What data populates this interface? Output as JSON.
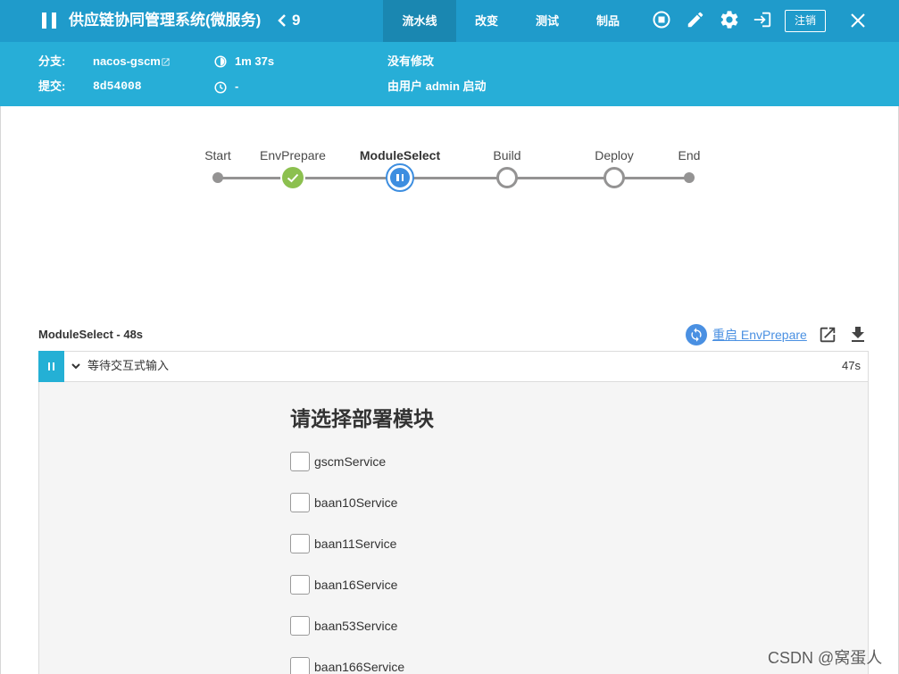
{
  "colors": {
    "header_bar": "#1f9bcb",
    "header_band": "#27aed7",
    "active_tab": "#1a87b1",
    "success": "#8cc04f",
    "paused": "#3d8ee0",
    "step_paused": "#24b0d5",
    "not_built": "#949393",
    "link": "#4a90e2"
  },
  "header": {
    "pause_icon": "pause-icon",
    "title": "供应链协同管理系统(微服务)",
    "back_icon": "chevron-left-icon",
    "run_number": "9",
    "tabs": [
      {
        "label": "流水线",
        "active": true
      },
      {
        "label": "改变",
        "active": false
      },
      {
        "label": "测试",
        "active": false
      },
      {
        "label": "制品",
        "active": false
      }
    ],
    "actions": {
      "stop_icon": "stop-circle-icon",
      "edit_icon": "pencil-icon",
      "settings_icon": "gear-icon",
      "enter_icon": "sign-in-icon",
      "logout_label": "注销",
      "close_icon": "close-icon"
    }
  },
  "run_info": {
    "branch_label": "分支:",
    "branch": "nacos-gscm",
    "commit_label": "提交:",
    "commit": "8d54008",
    "duration": "1m 37s",
    "end_time": "-",
    "changes": "没有修改",
    "started_by": "由用户 admin 启动"
  },
  "pipeline": {
    "stages": [
      {
        "label": "Start",
        "icon": "start-dot-icon"
      },
      {
        "label": "EnvPrepare",
        "icon": "success-check-icon"
      },
      {
        "label": "ModuleSelect",
        "icon": "paused-icon",
        "selected": true
      },
      {
        "label": "Build",
        "icon": "not-built-icon"
      },
      {
        "label": "Deploy",
        "icon": "not-built-icon"
      },
      {
        "label": "End",
        "icon": "end-dot-icon"
      }
    ]
  },
  "step_panel": {
    "title": "ModuleSelect - 48s",
    "restart_label": "重启 EnvPrepare",
    "step": {
      "label": "等待交互式输入",
      "duration": "47s"
    },
    "input": {
      "heading": "请选择部署模块",
      "options": [
        {
          "label": "gscmService",
          "checked": false
        },
        {
          "label": "baan10Service",
          "checked": false
        },
        {
          "label": "baan11Service",
          "checked": false
        },
        {
          "label": "baan16Service",
          "checked": false
        },
        {
          "label": "baan53Service",
          "checked": false
        },
        {
          "label": "baan166Service",
          "checked": false
        }
      ]
    }
  },
  "watermark": "CSDN @窝蛋人"
}
